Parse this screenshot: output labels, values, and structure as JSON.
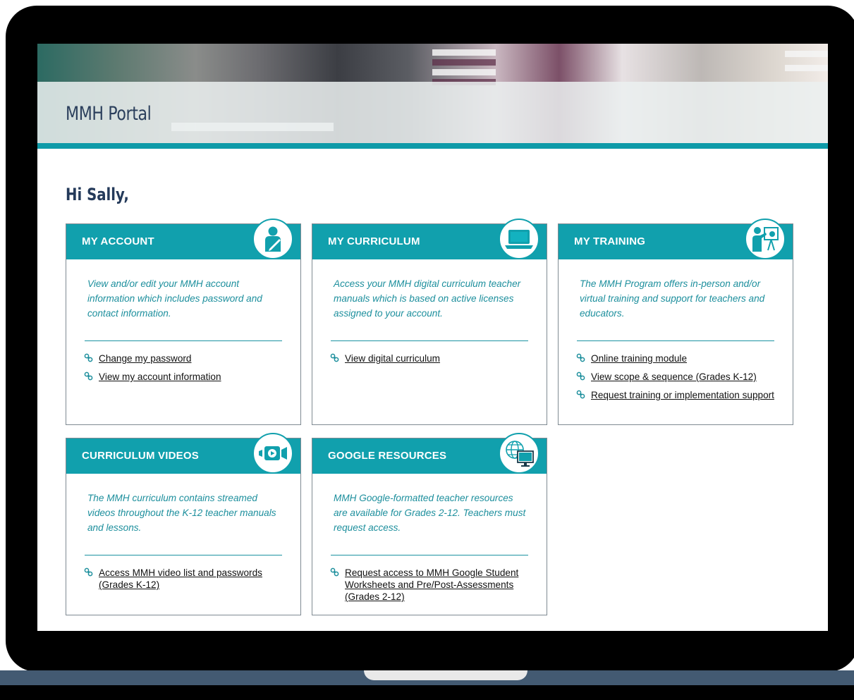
{
  "portal": {
    "title": "MMH Portal",
    "greeting": "Hi Sally,"
  },
  "colors": {
    "accent": "#11a0ad",
    "heading": "#243a5a",
    "description": "#1d8f9d"
  },
  "cards": [
    {
      "title": "MY ACCOUNT",
      "icon": "user-edit-icon",
      "description": "View and/or edit your MMH account information which includes password and contact information.",
      "links": [
        "Change my password",
        "View my account information"
      ]
    },
    {
      "title": "MY CURRICULUM",
      "icon": "laptop-icon",
      "description": "Access your MMH digital curriculum teacher manuals which is based on active licenses assigned to your account.",
      "links": [
        "View digital curriculum"
      ]
    },
    {
      "title": "MY TRAINING",
      "icon": "presenter-icon",
      "description": "The MMH Program offers in-person and/or virtual training and support for teachers and educators.",
      "links": [
        "Online training module",
        "View scope & sequence (Grades K-12)",
        "Request training or implementation support"
      ]
    },
    {
      "title": "CURRICULUM VIDEOS",
      "icon": "video-camera-icon",
      "description": "The MMH curriculum contains streamed videos throughout the K-12 teacher manuals and lessons.",
      "links": [
        "Access MMH video list and passwords (Grades K-12)"
      ]
    },
    {
      "title": "GOOGLE RESOURCES",
      "icon": "globe-monitor-icon",
      "description": "MMH Google-formatted teacher resources are available for Grades 2-12.  Teachers must request access.",
      "links": [
        "Request access to MMH Google Student Worksheets and Pre/Post-Assessments (Grades 2-12)"
      ]
    }
  ]
}
